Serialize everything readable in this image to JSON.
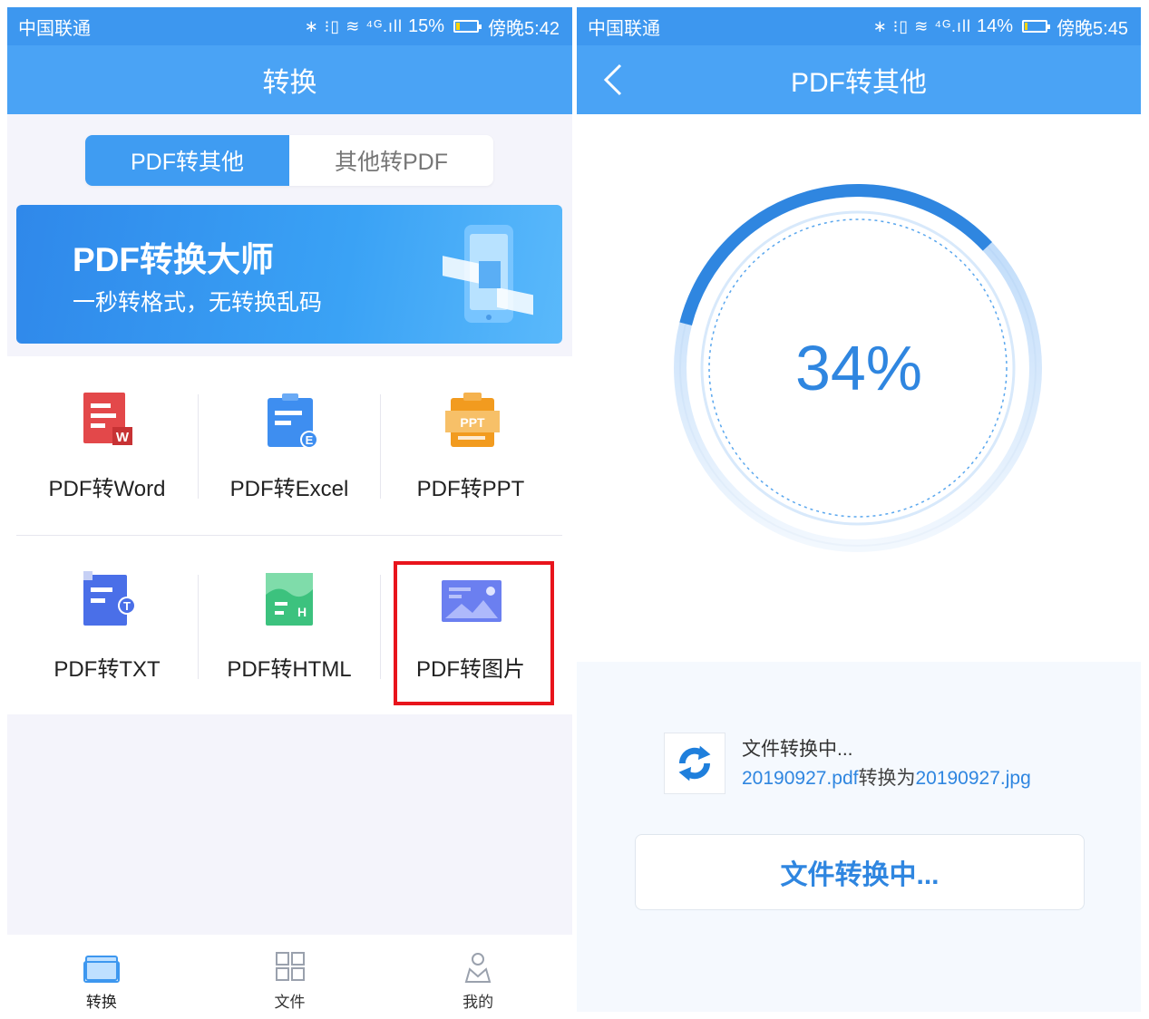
{
  "left_screen": {
    "status": {
      "carrier": "中国联通",
      "icons": "∗ ⁝▯ ≋ ⁴ᴳ.ıll",
      "battery": "15%",
      "time": "傍晚5:42",
      "battery_fraction": 0.15
    },
    "title": "转换",
    "tabs": [
      {
        "label": "PDF转其他",
        "active": true
      },
      {
        "label": "其他转PDF",
        "active": false
      }
    ],
    "banner": {
      "title": "PDF转换大师",
      "subtitle": "一秒转格式，无转换乱码"
    },
    "tools": [
      {
        "label": "PDF转Word",
        "icon": "word-icon",
        "color": "#e3484a",
        "badge": "W"
      },
      {
        "label": "PDF转Excel",
        "icon": "excel-icon",
        "color": "#3e8ef0",
        "badge": "E"
      },
      {
        "label": "PDF转PPT",
        "icon": "ppt-icon",
        "color": "#f29b1f",
        "badge": "PPT"
      },
      {
        "label": "PDF转TXT",
        "icon": "txt-icon",
        "color": "#4a6fe8",
        "badge": "T"
      },
      {
        "label": "PDF转HTML",
        "icon": "html-icon",
        "color": "#3cc27e",
        "badge": "H"
      },
      {
        "label": "PDF转图片",
        "icon": "image-icon",
        "color": "#6b7ff0",
        "badge": ""
      }
    ],
    "bottom_nav": [
      {
        "label": "转换",
        "icon": "folder-icon",
        "active": true
      },
      {
        "label": "文件",
        "icon": "grid-icon",
        "active": false
      },
      {
        "label": "我的",
        "icon": "profile-icon",
        "active": false
      }
    ],
    "highlighted_tool": "PDF转图片",
    "highlight_color": "#e8141c"
  },
  "right_screen": {
    "status": {
      "carrier": "中国联通",
      "icons": "∗ ⁝▯ ≋ ⁴ᴳ.ıll",
      "battery": "14%",
      "time": "傍晚5:45",
      "battery_fraction": 0.14
    },
    "title": "PDF转其他",
    "progress": {
      "percent_text": "34%",
      "value": 0.34
    },
    "file": {
      "status": "文件转换中...",
      "source": "20190927.pdf",
      "connector": "转换为",
      "target": "20190927.jpg",
      "icon": "sync-icon"
    },
    "button": "文件转换中..."
  },
  "colors": {
    "accent": "#3d97ef",
    "text_blue": "#2f86e0"
  }
}
